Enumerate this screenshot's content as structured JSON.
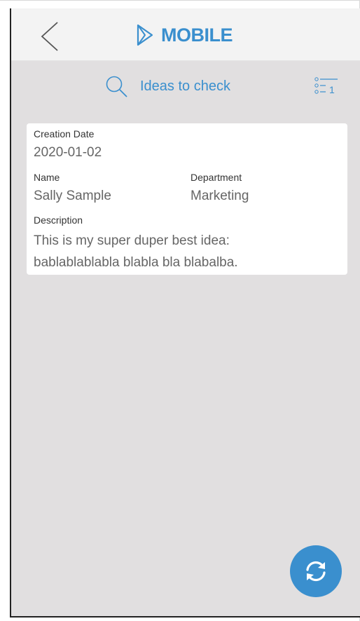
{
  "header": {
    "back_icon": "chevron-left-icon",
    "brand_logo_icon": "play-triangle-logo-icon",
    "brand_title": "MOBILE"
  },
  "search": {
    "icon": "search-icon",
    "label": "Ideas to check",
    "filter_icon": "filter-list-icon",
    "filter_count": "1"
  },
  "card": {
    "creation_date_label": "Creation Date",
    "creation_date_value": "2020-01-02",
    "name_label": "Name",
    "name_value": "Sally Sample",
    "department_label": "Department",
    "department_value": "Marketing",
    "description_label": "Description",
    "description_lines": [
      "This is my super duper best idea:",
      "bablablablabla blabla bla blabalba."
    ]
  },
  "fab": {
    "icon": "refresh-icon"
  },
  "colors": {
    "accent": "#3a8fce",
    "background": "#e1dfe0",
    "header_bg": "#f3f3f3",
    "card_bg": "#ffffff"
  }
}
